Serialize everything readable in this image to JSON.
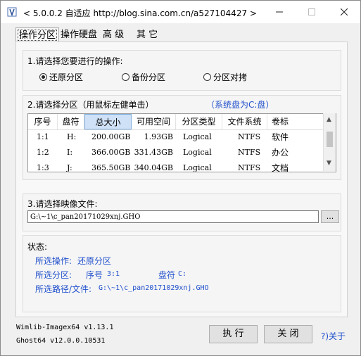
{
  "title": "< 5.0.0.2 自适应 http://blog.sina.com.cn/a527104427 >",
  "tabs": [
    "操作分区",
    "操作硬盘",
    "高 级",
    "其 它"
  ],
  "operation": {
    "label": "1.请选择您要进行的操作:",
    "options": [
      "还原分区",
      "备份分区",
      "分区对拷"
    ],
    "selected": "还原分区"
  },
  "partition": {
    "label": "2.请选择分区（用鼠标左健单击）",
    "system_note": "（系统盘为C:盘）",
    "columns": [
      "序号",
      "盘符",
      "总大小",
      "可用空间",
      "分区类型",
      "文件系统",
      "卷标"
    ],
    "rows": [
      [
        "1:1",
        "H:",
        "200.00GB",
        "1.93GB",
        "Logical",
        "NTFS",
        "软件"
      ],
      [
        "1:2",
        "I:",
        "366.00GB",
        "331.43GB",
        "Logical",
        "NTFS",
        "办公"
      ],
      [
        "1:3",
        "J:",
        "365.50GB",
        "340.04GB",
        "Logical",
        "NTFS",
        "文档"
      ]
    ]
  },
  "image_file": {
    "label": "3.请选择映像文件:",
    "path": "G:\\~1\\c_pan20171029xnj.GHO",
    "browse_label": "..."
  },
  "status": {
    "heading": "状态:",
    "op_label": "所选操作:",
    "op_value": "还原分区",
    "part_label": "所选分区:",
    "part_num_label": "序号",
    "part_num_value": "3:1",
    "part_drive_label": "盘符",
    "part_drive_value": "C:",
    "path_label": "所选路径/文件:",
    "path_value": "G:\\~1\\c_pan20171029xnj.GHO"
  },
  "footer": {
    "wimlib": "Wimlib-Imagex64 v1.13.1",
    "ghost": "Ghost64 v12.0.0.10531",
    "execute_label": "执 行",
    "close_label": "关 闭",
    "about_label": "?)关于"
  },
  "colors": {
    "accent": "#1f4fcc"
  }
}
